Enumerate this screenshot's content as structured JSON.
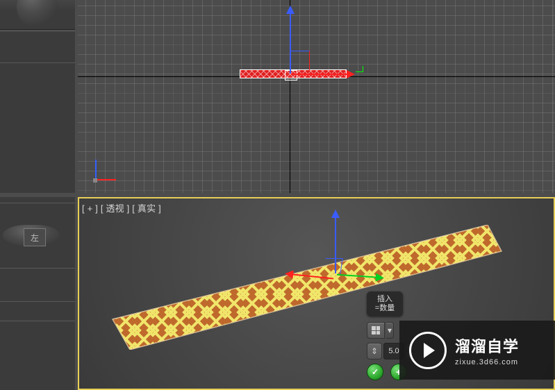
{
  "viewport": {
    "perspective_label": "[ + ] [ 透视 ] [ 真实 ]",
    "viewcube_face": "左"
  },
  "tooltip": {
    "line1": "插入",
    "line2": "=数量"
  },
  "spinner": {
    "value": "5.0"
  },
  "icons": {
    "grid": "grid-icon",
    "dropdown": "▾",
    "updown": "⇕",
    "ok": "✓",
    "plus": "+",
    "up": "▴",
    "down": "▾"
  },
  "watermark": {
    "title": "溜溜自学",
    "subtitle": "zixue.3d66.com"
  }
}
